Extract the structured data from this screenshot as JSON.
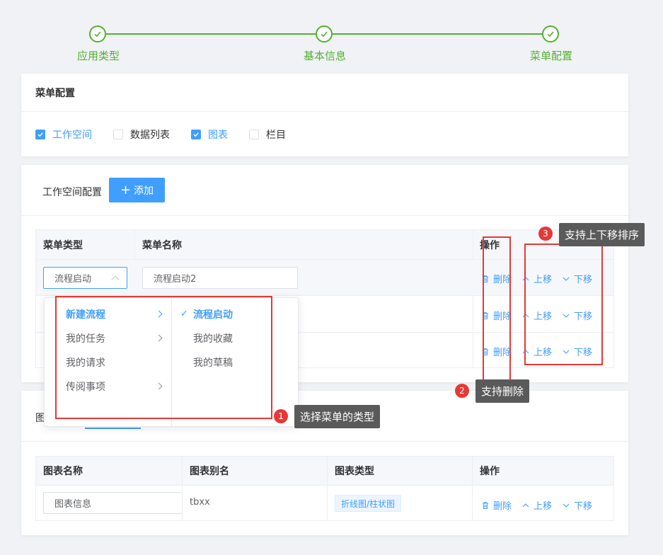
{
  "steps": [
    {
      "label": "应用类型"
    },
    {
      "label": "基本信息"
    },
    {
      "label": "菜单配置"
    }
  ],
  "menu_config": {
    "title": "菜单配置",
    "options": [
      {
        "label": "工作空间",
        "checked": true
      },
      {
        "label": "数据列表",
        "checked": false
      },
      {
        "label": "图表",
        "checked": true
      },
      {
        "label": "栏目",
        "checked": false
      }
    ]
  },
  "workspace": {
    "title": "工作空间配置",
    "add_label": "添加",
    "columns": [
      "菜单类型",
      "菜单名称",
      "操作"
    ],
    "rows": [
      {
        "type": "流程启动",
        "name": "流程启动2"
      },
      {
        "type": "",
        "name": ""
      },
      {
        "type": "",
        "name": ""
      }
    ],
    "ops": {
      "delete": "删除",
      "up": "上移",
      "down": "下移"
    }
  },
  "dropdown": {
    "left": [
      {
        "label": "新建流程",
        "has_children": true,
        "active": true
      },
      {
        "label": "我的任务",
        "has_children": true,
        "active": false
      },
      {
        "label": "我的请求",
        "has_children": false,
        "active": false
      },
      {
        "label": "传阅事项",
        "has_children": true,
        "active": false
      }
    ],
    "right": [
      {
        "label": "流程启动",
        "selected": true
      },
      {
        "label": "我的收藏",
        "selected": false
      },
      {
        "label": "我的草稿",
        "selected": false
      }
    ]
  },
  "chart_section": {
    "title_partial": "图",
    "columns": [
      "图表名称",
      "图表别名",
      "图表类型",
      "操作"
    ],
    "rows": [
      {
        "name": "图表信息",
        "alias": "tbxx",
        "type": "折线图/柱状图"
      }
    ],
    "ops": {
      "delete": "删除",
      "up": "上移",
      "down": "下移"
    }
  },
  "annotations": [
    {
      "num": "1",
      "text": "选择菜单的类型"
    },
    {
      "num": "2",
      "text": "支持删除"
    },
    {
      "num": "3",
      "text": "支持上下移排序"
    }
  ],
  "colors": {
    "primary": "#409eff",
    "success": "#52b030",
    "annotation": "#e53935"
  }
}
